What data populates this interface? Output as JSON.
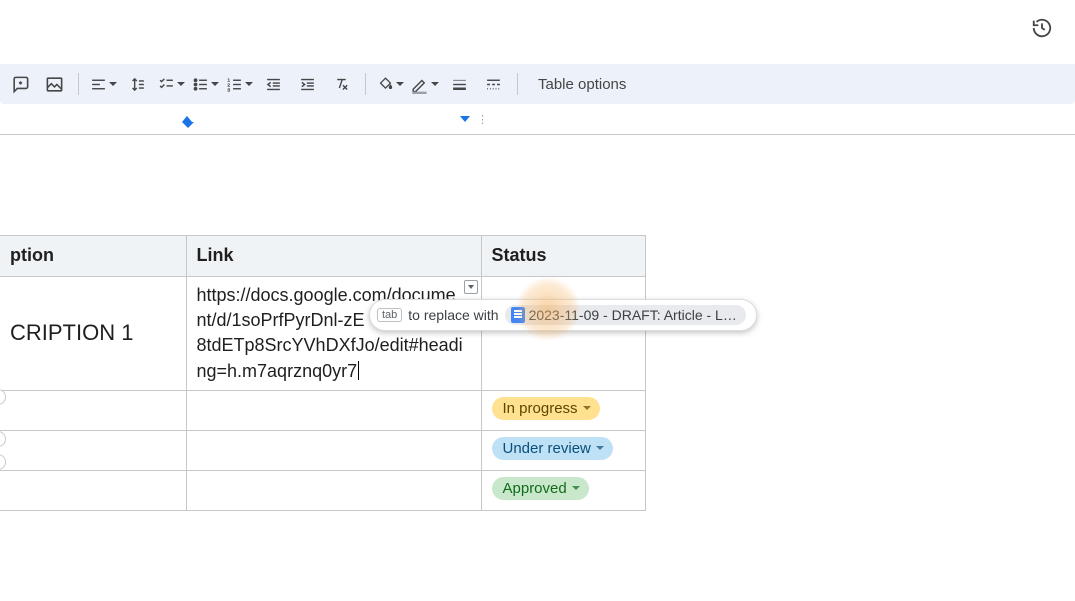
{
  "toolbar": {
    "table_options": "Table options"
  },
  "table": {
    "headers": {
      "desc": "ption",
      "link": "Link",
      "status": "Status"
    },
    "rows": [
      {
        "desc": "CRIPTION 1",
        "link_lines": [
          "https://docs.google.com/docume",
          "nt/d/1soPrfPyrDnl-zE",
          "8tdETp8SrcYVhDXfJo/edit#headi",
          "ng=h.m7aqrznq0yr7"
        ],
        "status_label": ""
      },
      {
        "desc": "",
        "link_lines": [],
        "status_label": "In progress",
        "status_class": "inprogress"
      },
      {
        "desc": "",
        "link_lines": [],
        "status_label": "Under review",
        "status_class": "review"
      },
      {
        "desc": "",
        "link_lines": [],
        "status_label": "Approved",
        "status_class": "approved"
      }
    ]
  },
  "suggestion": {
    "tab_key": "tab",
    "middle": "to replace with",
    "chip_text": "2023-11-09 - DRAFT: Article - L…"
  }
}
